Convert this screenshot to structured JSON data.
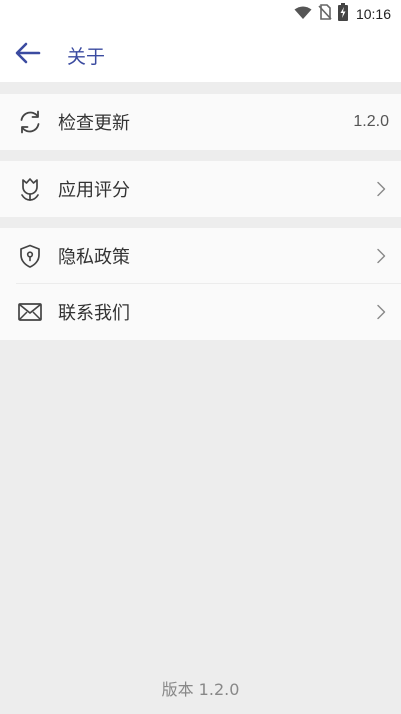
{
  "status_bar": {
    "time": "10:16",
    "icons": [
      "wifi-icon",
      "no-sim-icon",
      "battery-charging-icon"
    ]
  },
  "app_bar": {
    "title": "关于",
    "back_icon": "arrow-left-icon"
  },
  "groups": [
    {
      "rows": [
        {
          "icon": "refresh-icon",
          "label": "检查更新",
          "value": "1.2.0"
        }
      ]
    },
    {
      "rows": [
        {
          "icon": "tulip-icon",
          "label": "应用评分",
          "chevron": "chevron-right-icon"
        }
      ]
    },
    {
      "rows": [
        {
          "icon": "shield-icon",
          "label": "隐私政策",
          "chevron": "chevron-right-icon"
        },
        {
          "icon": "mail-icon",
          "label": "联系我们",
          "chevron": "chevron-right-icon"
        }
      ]
    }
  ],
  "footer": {
    "version_text": "版本 1.2.0"
  },
  "colors": {
    "accent": "#3b4ba0",
    "background": "#ededed",
    "card": "#fafafa"
  }
}
